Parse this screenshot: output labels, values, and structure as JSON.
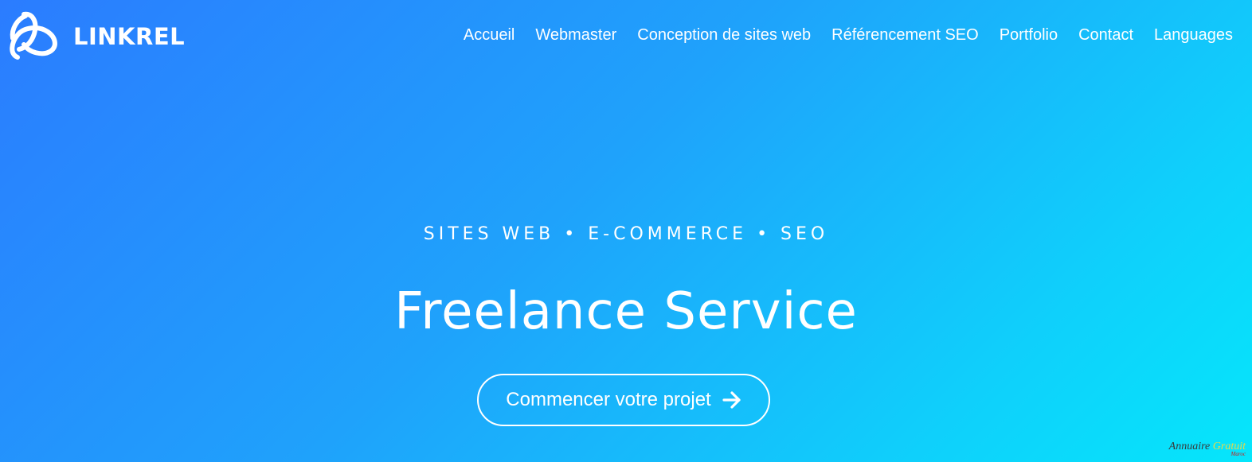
{
  "brand": {
    "name": "LINKREL",
    "icon": "linkrel-logo-icon"
  },
  "nav": {
    "items": [
      {
        "label": "Accueil"
      },
      {
        "label": "Webmaster"
      },
      {
        "label": "Conception de sites web"
      },
      {
        "label": "Référencement SEO"
      },
      {
        "label": "Portfolio"
      },
      {
        "label": "Contact"
      },
      {
        "label": "Languages"
      }
    ]
  },
  "hero": {
    "kicker": "SITES WEB • E-COMMERCE • SEO",
    "title": "Freelance Service",
    "cta_label": "Commencer votre projet",
    "cta_icon": "arrow-right-icon"
  },
  "watermark": {
    "line1_a": "Annuaire ",
    "line1_b": "Gratuit",
    "line2": "Maroc"
  },
  "colors": {
    "gradient_start": "#2b7cff",
    "gradient_end": "#05e6fb",
    "text": "#ffffff"
  }
}
